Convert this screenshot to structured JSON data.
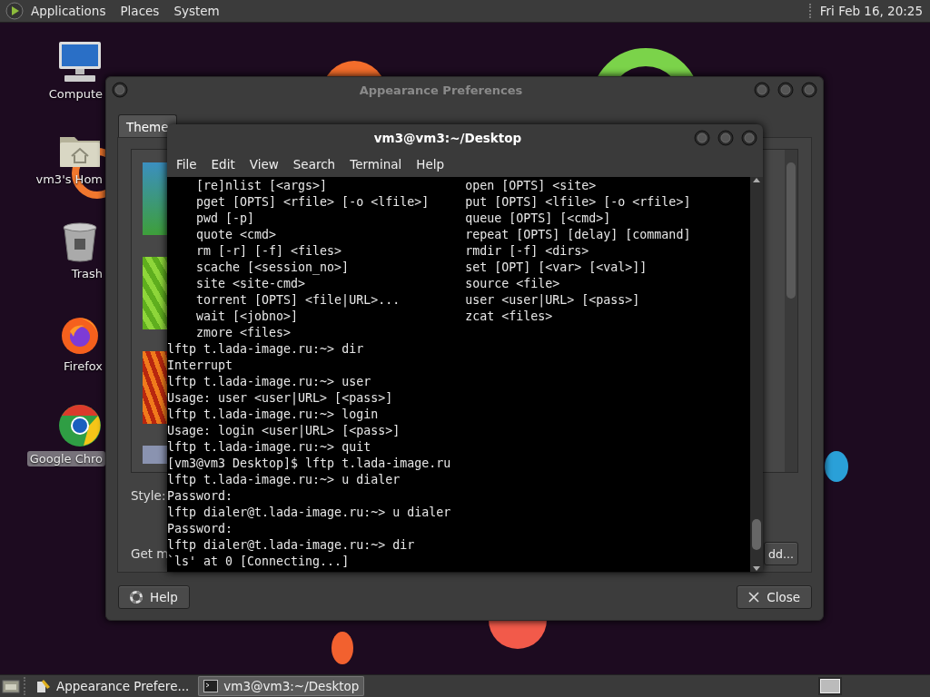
{
  "top_panel": {
    "menus": [
      "Applications",
      "Places",
      "System"
    ],
    "clock": "Fri Feb 16, 20:25"
  },
  "desktop_icons": [
    {
      "kind": "computer",
      "label": "Compute",
      "selected": false
    },
    {
      "kind": "home",
      "label": "vm3's Hom",
      "selected": false
    },
    {
      "kind": "trash",
      "label": "Trash",
      "selected": false
    },
    {
      "kind": "firefox",
      "label": "Firefox",
      "selected": false
    },
    {
      "kind": "chrome",
      "label": "Google Chro",
      "selected": true
    }
  ],
  "appearance_window": {
    "title": "Appearance Preferences",
    "tabs": [
      {
        "label": "Theme",
        "selected": true
      }
    ],
    "style_label": "Style:",
    "get_more_label": "Get m",
    "add_button": "dd...",
    "help_button": "Help",
    "close_button": "Close"
  },
  "terminal_window": {
    "title": "vm3@vm3:~/Desktop",
    "menus": [
      "File",
      "Edit",
      "View",
      "Search",
      "Terminal",
      "Help"
    ],
    "lines": [
      {
        "kind": "help",
        "left": "[re]nlist [<args>]",
        "right": "open [OPTS] <site>"
      },
      {
        "kind": "help",
        "left": "pget [OPTS] <rfile> [-o <lfile>]",
        "right": "put [OPTS] <lfile> [-o <rfile>]"
      },
      {
        "kind": "help",
        "left": "pwd [-p]",
        "right": "queue [OPTS] [<cmd>]"
      },
      {
        "kind": "help",
        "left": "quote <cmd>",
        "right": "repeat [OPTS] [delay] [command]"
      },
      {
        "kind": "help",
        "left": "rm [-r] [-f] <files>",
        "right": "rmdir [-f] <dirs>"
      },
      {
        "kind": "help",
        "left": "scache [<session_no>]",
        "right": "set [OPT] [<var> [<val>]]"
      },
      {
        "kind": "help",
        "left": "site <site-cmd>",
        "right": "source <file>"
      },
      {
        "kind": "help",
        "left": "torrent [OPTS] <file|URL>...",
        "right": "user <user|URL> [<pass>]"
      },
      {
        "kind": "help",
        "left": "wait [<jobno>]",
        "right": "zcat <files>"
      },
      {
        "kind": "help",
        "left": "zmore <files>"
      },
      {
        "kind": "output",
        "text": "lftp t.lada-image.ru:~> dir"
      },
      {
        "kind": "output",
        "text": "Interrupt"
      },
      {
        "kind": "output",
        "text": "lftp t.lada-image.ru:~> user"
      },
      {
        "kind": "output",
        "text": "Usage: user <user|URL> [<pass>]"
      },
      {
        "kind": "output",
        "text": "lftp t.lada-image.ru:~> login"
      },
      {
        "kind": "output",
        "text": "Usage: login <user|URL> [<pass>]"
      },
      {
        "kind": "output",
        "text": "lftp t.lada-image.ru:~> quit"
      },
      {
        "kind": "output",
        "text": "[vm3@vm3 Desktop]$ lftp t.lada-image.ru"
      },
      {
        "kind": "output",
        "text": "lftp t.lada-image.ru:~> u dialer"
      },
      {
        "kind": "output",
        "text": "Password:"
      },
      {
        "kind": "output",
        "text": "lftp dialer@t.lada-image.ru:~> u dialer"
      },
      {
        "kind": "output",
        "text": "Password:"
      },
      {
        "kind": "output",
        "text": "lftp dialer@t.lada-image.ru:~> dir"
      },
      {
        "kind": "output",
        "text": "`ls' at 0 [Connecting...]"
      }
    ]
  },
  "taskbar": {
    "items": [
      {
        "kind": "appearance",
        "label": "Appearance Prefere...",
        "selected": false
      },
      {
        "kind": "terminal",
        "label": "vm3@vm3:~/Desktop",
        "selected": true
      }
    ]
  }
}
